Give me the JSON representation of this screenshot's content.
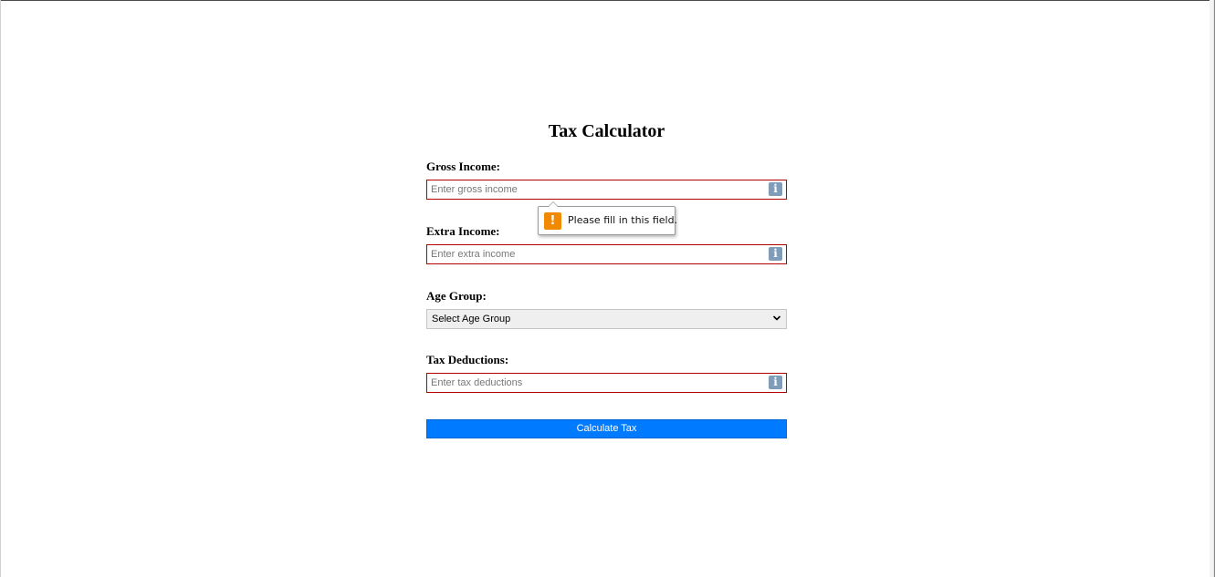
{
  "page": {
    "title": "Tax Calculator"
  },
  "form": {
    "gross_income": {
      "label": "Gross Income:",
      "placeholder": "Enter gross income",
      "value": "",
      "icon": "info-icon"
    },
    "extra_income": {
      "label": "Extra Income:",
      "placeholder": "Enter extra income",
      "value": "",
      "icon": "info-icon"
    },
    "age_group": {
      "label": "Age Group:",
      "selected": "Select Age Group"
    },
    "tax_deductions": {
      "label": "Tax Deductions:",
      "placeholder": "Enter tax deductions",
      "value": "",
      "icon": "info-icon"
    },
    "submit_label": "Calculate Tax"
  },
  "tooltip": {
    "message": "Please fill in this field.",
    "icon": "warning-icon"
  },
  "colors": {
    "error_border": "#b00000",
    "button_bg": "#007bff",
    "warning": "#f18a00",
    "info_icon": "#7f9db9"
  }
}
